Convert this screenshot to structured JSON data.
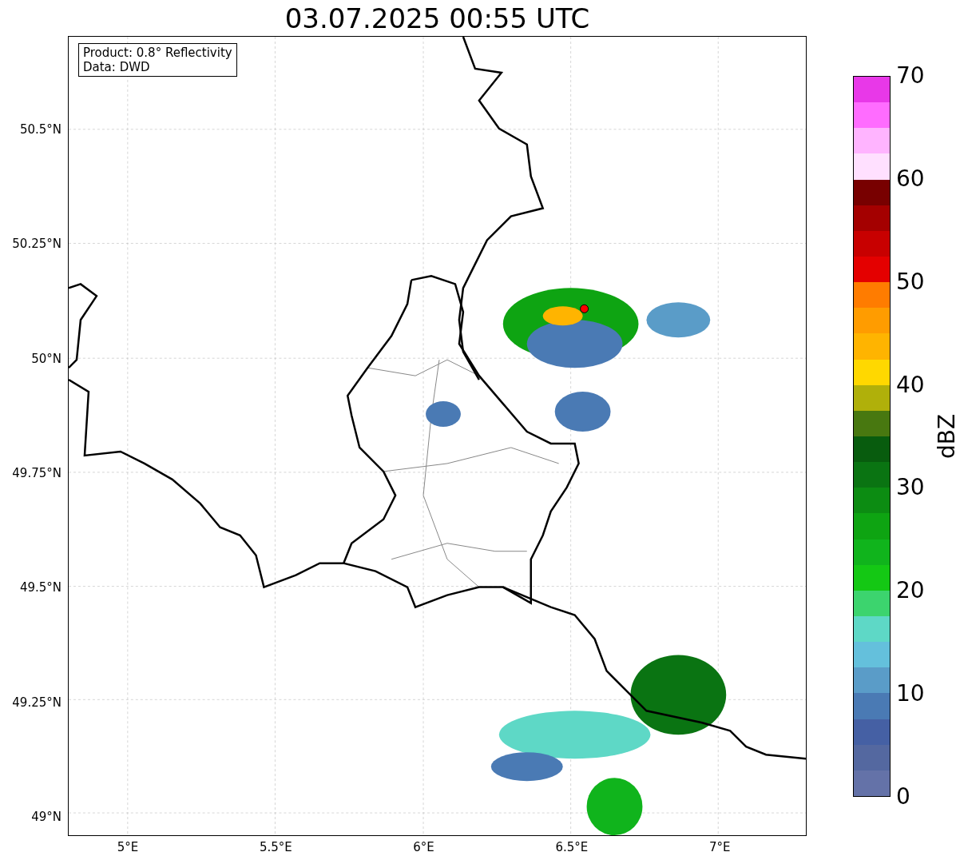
{
  "title": "03.07.2025 00:55 UTC",
  "info_box": [
    "Product: 0.8° Reflectivity",
    "Data: DWD"
  ],
  "map": {
    "xticks": [
      "5°E",
      "5.5°E",
      "6°E",
      "6.5°E",
      "7°E"
    ],
    "yticks": [
      "50.5°N",
      "50.25°N",
      "50°N",
      "49.75°N",
      "49.5°N",
      "49.25°N",
      "49°N"
    ]
  },
  "colorbar": {
    "label": "dBZ",
    "ticks": [
      "70",
      "60",
      "50",
      "40",
      "30",
      "20",
      "10",
      "0"
    ],
    "bands": [
      {
        "color": "#e838e8"
      },
      {
        "color": "#ff6cff"
      },
      {
        "color": "#ffb4ff"
      },
      {
        "color": "#ffe0ff"
      },
      {
        "color": "#780000"
      },
      {
        "color": "#a40000"
      },
      {
        "color": "#c80000"
      },
      {
        "color": "#e40000"
      },
      {
        "color": "#ff7c00"
      },
      {
        "color": "#ff9c00"
      },
      {
        "color": "#ffb400"
      },
      {
        "color": "#ffd800"
      },
      {
        "color": "#b0b00a"
      },
      {
        "color": "#487810"
      },
      {
        "color": "#085c0e"
      },
      {
        "color": "#0a7412"
      },
      {
        "color": "#0c8c12"
      },
      {
        "color": "#0ea412"
      },
      {
        "color": "#10b41c"
      },
      {
        "color": "#14c814"
      },
      {
        "color": "#3cd46e"
      },
      {
        "color": "#5ed8c6"
      },
      {
        "color": "#64c0dc"
      },
      {
        "color": "#5a9cc8"
      },
      {
        "color": "#4a7ab4"
      },
      {
        "color": "#4560a4"
      },
      {
        "color": "#5468a0"
      },
      {
        "color": "#6472a8"
      }
    ]
  }
}
